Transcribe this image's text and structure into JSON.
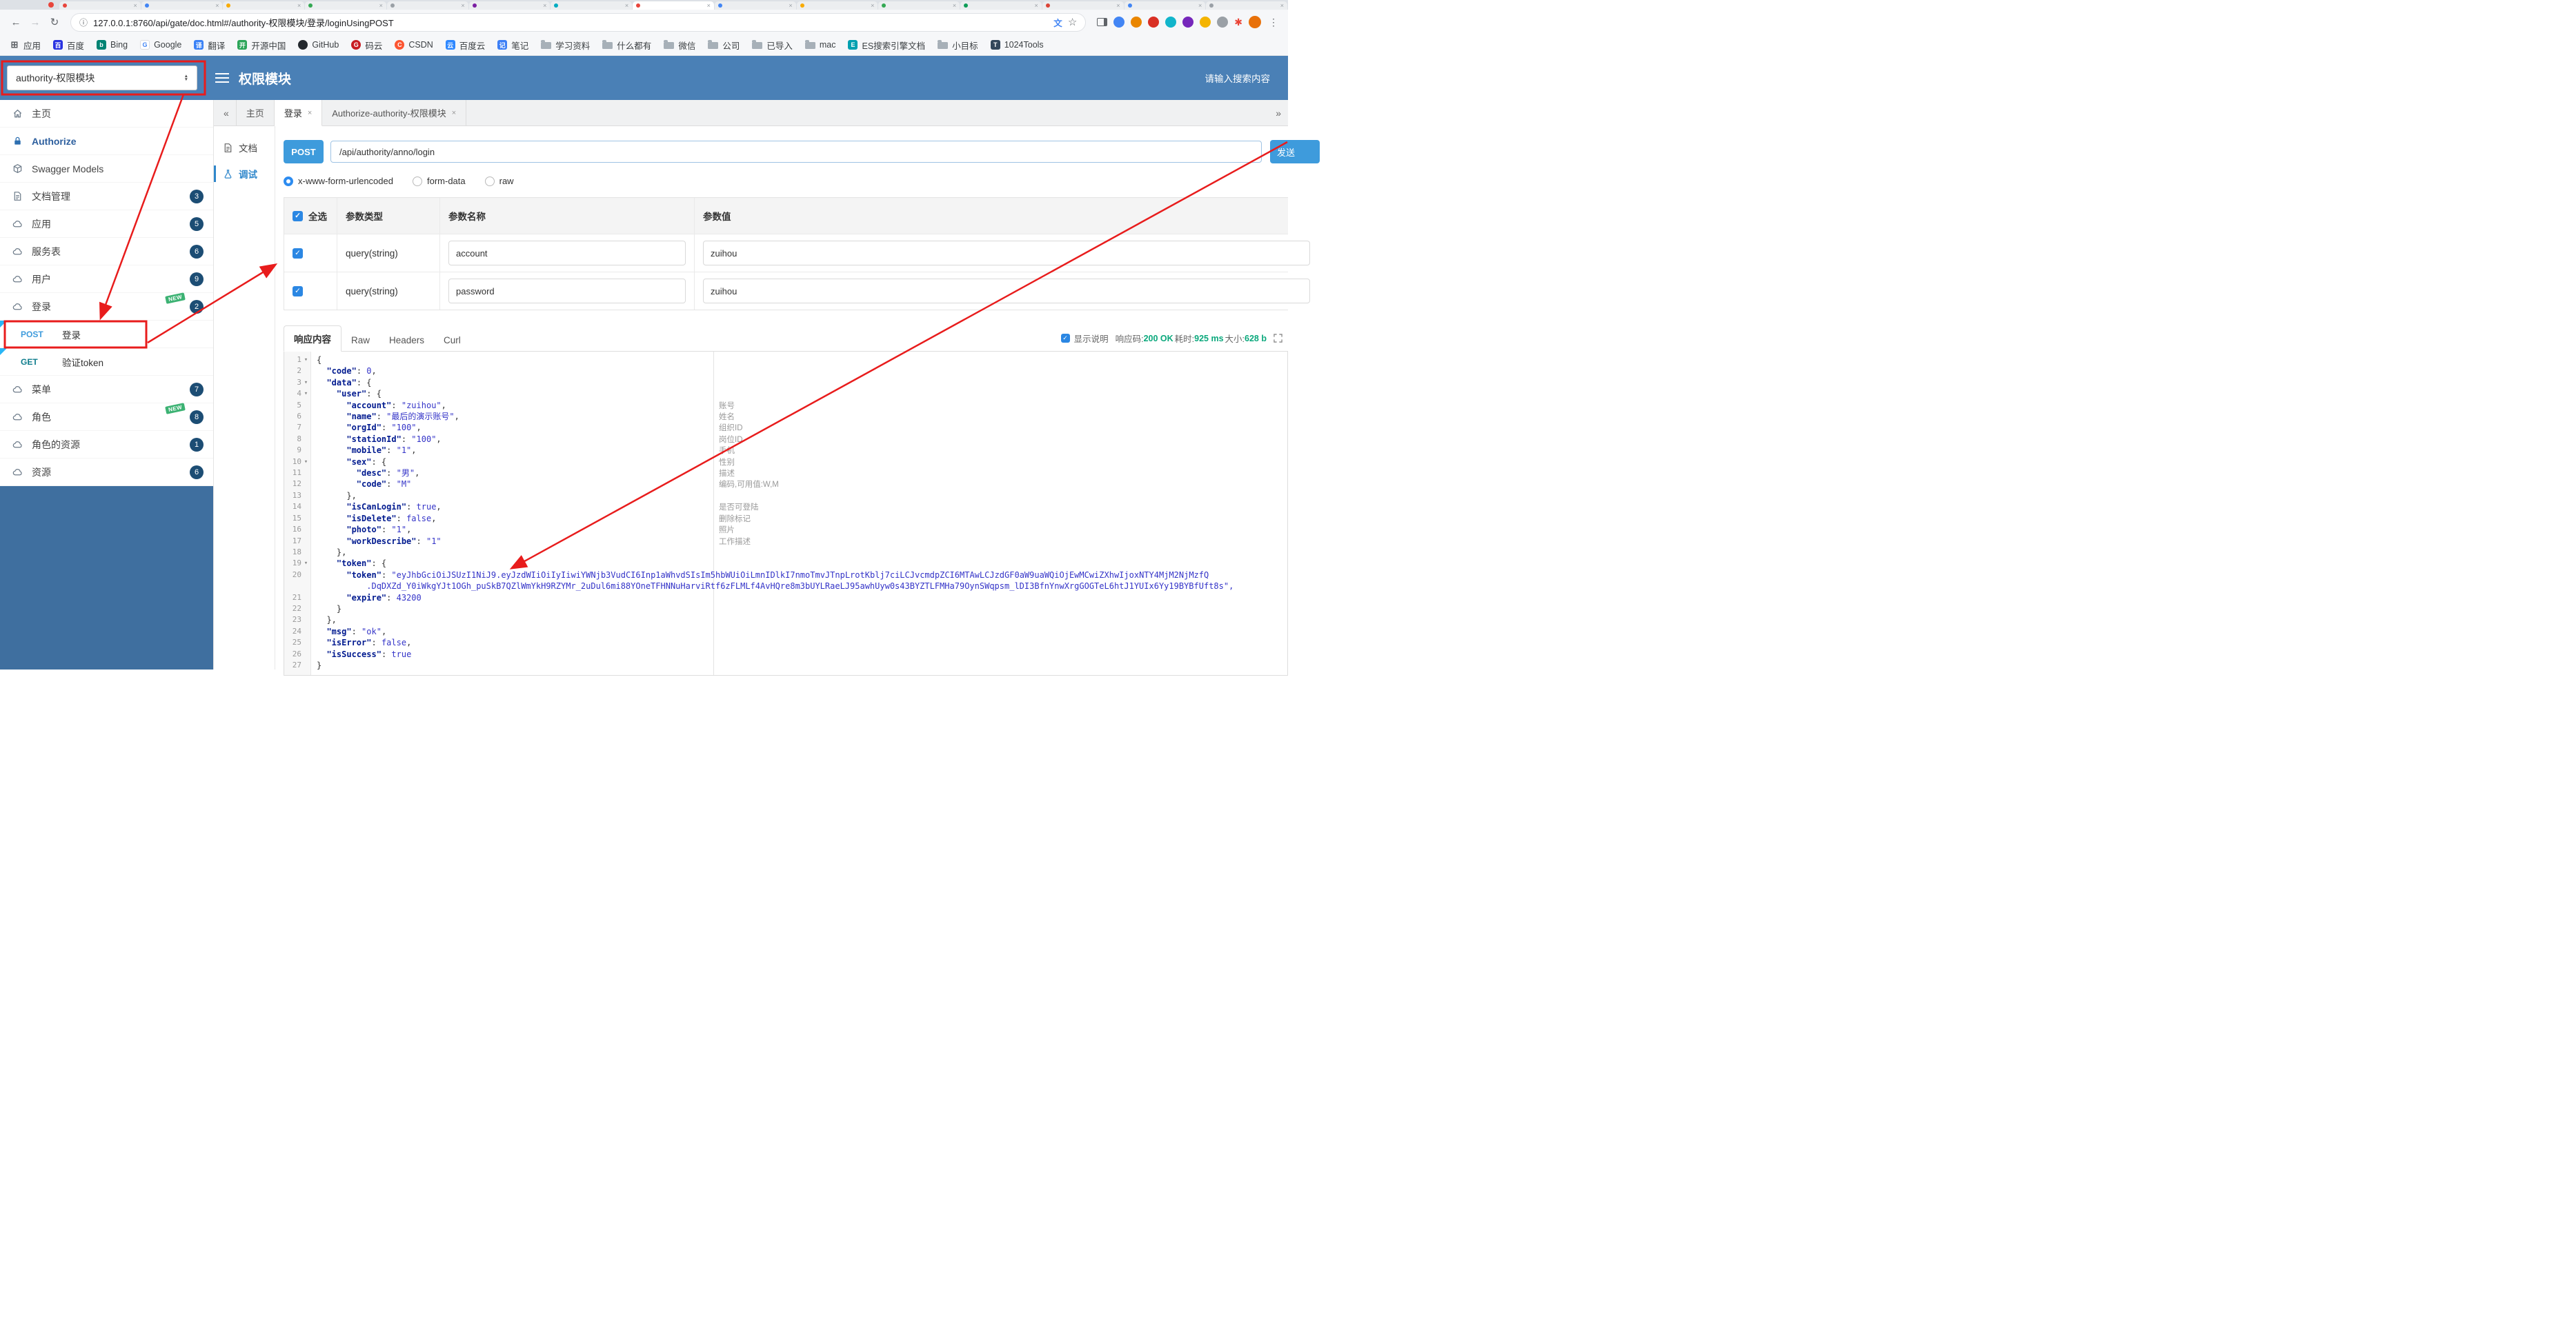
{
  "colors": {
    "header_blue": "#4a80b6",
    "sidebar_blue": "#3f6f9f",
    "accent_blue": "#3e9bdc",
    "badge_navy": "#1c4d74",
    "new_green": "#3cb273",
    "status_green": "#0aa87c",
    "annotation_red": "#e81c1c",
    "code_key": "#001a8f",
    "code_value": "#3434c8"
  },
  "browser": {
    "url": "127.0.0.1:8760/api/gate/doc.html#/authority-权限模块/登录/loginUsingPOST",
    "bookmarks": [
      {
        "label": "应用",
        "icon": "apps-grid-icon"
      },
      {
        "label": "百度",
        "icon": "baidu-icon"
      },
      {
        "label": "Bing",
        "icon": "bing-icon"
      },
      {
        "label": "Google",
        "icon": "google-icon"
      },
      {
        "label": "翻译",
        "icon": "translate-page-icon"
      },
      {
        "label": "开源中国",
        "icon": "oschina-icon"
      },
      {
        "label": "GitHub",
        "icon": "github-icon"
      },
      {
        "label": "码云",
        "icon": "gitee-icon"
      },
      {
        "label": "CSDN",
        "icon": "csdn-icon"
      },
      {
        "label": "百度云",
        "icon": "baiduyun-icon"
      },
      {
        "label": "笔记",
        "icon": "note-icon"
      },
      {
        "label": "学习资料",
        "icon": "folder-icon"
      },
      {
        "label": "什么都有",
        "icon": "folder-icon"
      },
      {
        "label": "微信",
        "icon": "folder-icon"
      },
      {
        "label": "公司",
        "icon": "folder-icon"
      },
      {
        "label": "已导入",
        "icon": "folder-icon"
      },
      {
        "label": "mac",
        "icon": "folder-icon"
      },
      {
        "label": "ES搜索引擎文档",
        "icon": "es-icon"
      },
      {
        "label": "小目标",
        "icon": "folder-icon"
      },
      {
        "label": "1024Tools",
        "icon": "tools-icon"
      }
    ]
  },
  "header": {
    "module_select": "authority-权限模块",
    "title": "权限模块",
    "search_placeholder": "请输入搜索内容"
  },
  "sidebar": {
    "items": [
      {
        "key": "home",
        "label": "主页",
        "icon": "home-icon"
      },
      {
        "key": "authorize",
        "label": "Authorize",
        "icon": "lock-icon",
        "emphasis": true
      },
      {
        "key": "swagger-models",
        "label": "Swagger Models",
        "icon": "models-icon"
      },
      {
        "key": "doc-manage",
        "label": "文档管理",
        "icon": "file-icon",
        "badge": "3"
      },
      {
        "key": "app",
        "label": "应用",
        "icon": "cloud-icon",
        "badge": "5"
      },
      {
        "key": "service",
        "label": "服务表",
        "icon": "cloud-icon",
        "badge": "6"
      },
      {
        "key": "user",
        "label": "用户",
        "icon": "cloud-icon",
        "badge": "9"
      },
      {
        "key": "login",
        "label": "登录",
        "icon": "cloud-icon",
        "badge": "2",
        "new_tag": "NEW"
      },
      {
        "key": "login-post",
        "method": "POST",
        "label": "登录",
        "flagged": true
      },
      {
        "key": "token-get",
        "method": "GET",
        "label": "验证token",
        "flagged": true
      },
      {
        "key": "menu",
        "label": "菜单",
        "icon": "cloud-icon",
        "badge": "7"
      },
      {
        "key": "role",
        "label": "角色",
        "icon": "cloud-icon",
        "badge": "8",
        "new_tag": "NEW"
      },
      {
        "key": "role-resource",
        "label": "角色的资源",
        "icon": "cloud-icon",
        "badge": "1"
      },
      {
        "key": "resource",
        "label": "资源",
        "icon": "cloud-icon",
        "badge": "6"
      }
    ]
  },
  "tabs": {
    "items": [
      {
        "key": "home",
        "label": "主页",
        "closable": false,
        "active": false
      },
      {
        "key": "login",
        "label": "登录",
        "closable": true,
        "active": true
      },
      {
        "key": "authorize",
        "label": "Authorize-authority-权限模块",
        "closable": true,
        "active": false
      }
    ]
  },
  "doc_nav": {
    "items": [
      {
        "key": "doc",
        "label": "文档",
        "icon": "document-icon",
        "active": false
      },
      {
        "key": "debug",
        "label": "调试",
        "icon": "debug-icon",
        "active": true
      }
    ]
  },
  "request": {
    "method": "POST",
    "path": "/api/authority/anno/login",
    "send_label": "发送",
    "content_types": [
      {
        "label": "x-www-form-urlencoded",
        "selected": true
      },
      {
        "label": "form-data",
        "selected": false
      },
      {
        "label": "raw",
        "selected": false
      }
    ],
    "params_table": {
      "headers": [
        "全选",
        "参数类型",
        "参数名称",
        "参数值"
      ],
      "rows": [
        {
          "checked": true,
          "type": "query(string)",
          "name": "account",
          "value": "zuihou"
        },
        {
          "checked": true,
          "type": "query(string)",
          "name": "password",
          "value": "zuihou"
        }
      ]
    }
  },
  "response": {
    "tabs": [
      {
        "label": "响应内容",
        "active": true
      },
      {
        "label": "Raw",
        "active": false
      },
      {
        "label": "Headers",
        "active": false
      },
      {
        "label": "Curl",
        "active": false
      }
    ],
    "show_desc_label": "显示说明",
    "meta": {
      "status_label": "响应码:",
      "status": "200 OK",
      "time_label": "耗时:",
      "time": "925 ms",
      "size_label": "大小:",
      "size": "628 b"
    },
    "code_lines": [
      {
        "n": 1,
        "text": "{"
      },
      {
        "n": 2,
        "text": "  \"code\": 0,"
      },
      {
        "n": 3,
        "text": "  \"data\": {"
      },
      {
        "n": 4,
        "text": "    \"user\": {"
      },
      {
        "n": 5,
        "text": "      \"account\": \"zuihou\",",
        "note": "账号"
      },
      {
        "n": 6,
        "text": "      \"name\": \"最后的演示账号\",",
        "note": "姓名"
      },
      {
        "n": 7,
        "text": "      \"orgId\": \"100\",",
        "note": "组织ID"
      },
      {
        "n": 8,
        "text": "      \"stationId\": \"100\",",
        "note": "岗位ID"
      },
      {
        "n": 9,
        "text": "      \"mobile\": \"1\",",
        "note": "手机"
      },
      {
        "n": 10,
        "text": "      \"sex\": {",
        "note": "性别"
      },
      {
        "n": 11,
        "text": "        \"desc\": \"男\",",
        "note": "描述"
      },
      {
        "n": 12,
        "text": "        \"code\": \"M\"",
        "note": "编码,可用值:W,M"
      },
      {
        "n": 13,
        "text": "      },"
      },
      {
        "n": 14,
        "text": "      \"isCanLogin\": true,",
        "note": "是否可登陆"
      },
      {
        "n": 15,
        "text": "      \"isDelete\": false,",
        "note": "删除标记"
      },
      {
        "n": 16,
        "text": "      \"photo\": \"1\",",
        "note": "照片"
      },
      {
        "n": 17,
        "text": "      \"workDescribe\": \"1\"",
        "note": "工作描述"
      },
      {
        "n": 18,
        "text": "    },"
      },
      {
        "n": 19,
        "text": "    \"token\": {"
      },
      {
        "n": 20,
        "text": "      \"token\": \"eyJhbGciOiJSUzI1NiJ9.eyJzdWIiOiIyIiwiYWNjb3VudCI6Inp1aWhvdSIsIm5hbWUiOiLmnIDlkI7nmoTmvJTnpLrotKblj7ciLCJvcmdpZCI6MTAwLCJzdGF0aW9uaWQiOjEwMCwiZXhwIjoxNTY4MjM2NjMzfQ"
      },
      {
        "n": null,
        "cont": true,
        "text": "          .DqDXZd_Y0iWkgYJt1OGh_puSkB7QZlWmYkH9RZYMr_2uDul6mi88YOneTFHNNuHarviRtf6zFLMLf4AvHQre8m3bUYLRaeLJ95awhUyw0s43BYZTLFMHa79OynSWqpsm_lDI3BfnYnwXrgGOGTeL6htJ1YUIx6Yy19BYBfUft8s\","
      },
      {
        "n": 21,
        "text": "      \"expire\": 43200"
      },
      {
        "n": 22,
        "text": "    }"
      },
      {
        "n": 23,
        "text": "  },"
      },
      {
        "n": 24,
        "text": "  \"msg\": \"ok\","
      },
      {
        "n": 25,
        "text": "  \"isError\": false,"
      },
      {
        "n": 26,
        "text": "  \"isSuccess\": true"
      },
      {
        "n": 27,
        "text": "}"
      }
    ]
  }
}
